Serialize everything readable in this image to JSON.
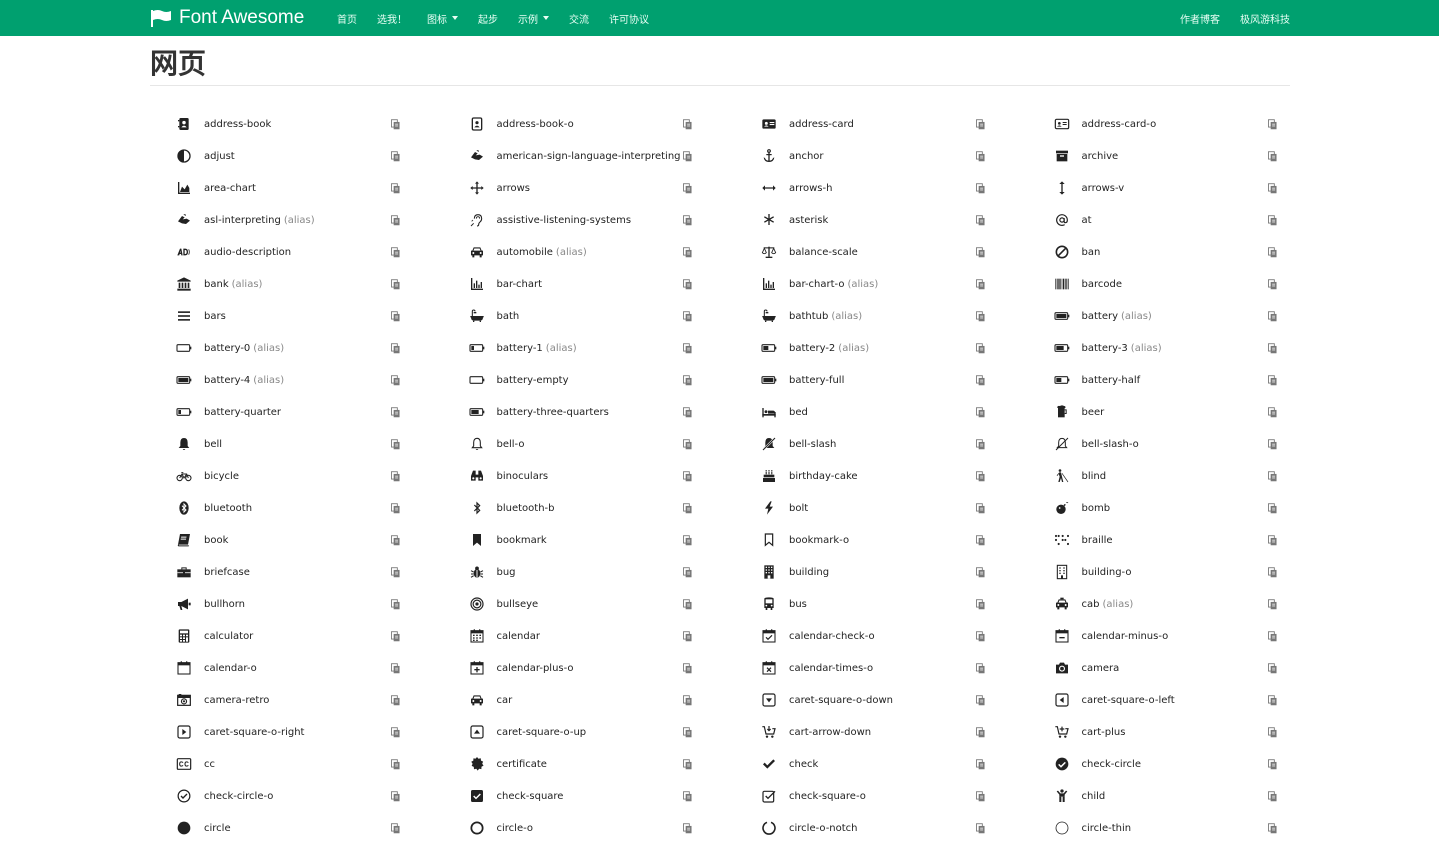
{
  "nav": {
    "brand": "Font Awesome",
    "left": [
      {
        "label": "首页",
        "dropdown": false
      },
      {
        "label": "选我！",
        "dropdown": false
      },
      {
        "label": "图标",
        "dropdown": true
      },
      {
        "label": "起步",
        "dropdown": false
      },
      {
        "label": "示例",
        "dropdown": true
      },
      {
        "label": "交流",
        "dropdown": false
      },
      {
        "label": "许可协议",
        "dropdown": false
      }
    ],
    "right": [
      {
        "label": "作者博客"
      },
      {
        "label": "极风游科技"
      }
    ]
  },
  "section_title": "网页",
  "alias_label": "(alias)",
  "colors": {
    "navbar": "#00a06f",
    "alias": "#888888"
  },
  "icons": [
    {
      "name": "address-book",
      "icon": "address-book-icon",
      "alias": false
    },
    {
      "name": "address-book-o",
      "icon": "address-book-o-icon",
      "alias": false
    },
    {
      "name": "address-card",
      "icon": "address-card-icon",
      "alias": false
    },
    {
      "name": "address-card-o",
      "icon": "address-card-o-icon",
      "alias": false
    },
    {
      "name": "adjust",
      "icon": "adjust-icon",
      "alias": false
    },
    {
      "name": "american-sign-language-interpreting",
      "icon": "asl-icon",
      "alias": false
    },
    {
      "name": "anchor",
      "icon": "anchor-icon",
      "alias": false
    },
    {
      "name": "archive",
      "icon": "archive-icon",
      "alias": false
    },
    {
      "name": "area-chart",
      "icon": "area-chart-icon",
      "alias": false
    },
    {
      "name": "arrows",
      "icon": "arrows-icon",
      "alias": false
    },
    {
      "name": "arrows-h",
      "icon": "arrows-h-icon",
      "alias": false
    },
    {
      "name": "arrows-v",
      "icon": "arrows-v-icon",
      "alias": false
    },
    {
      "name": "asl-interpreting",
      "icon": "asl-icon",
      "alias": true
    },
    {
      "name": "assistive-listening-systems",
      "icon": "ear-icon",
      "alias": false
    },
    {
      "name": "asterisk",
      "icon": "asterisk-icon",
      "alias": false
    },
    {
      "name": "at",
      "icon": "at-icon",
      "alias": false
    },
    {
      "name": "audio-description",
      "icon": "audio-description-icon",
      "alias": false
    },
    {
      "name": "automobile",
      "icon": "car-icon",
      "alias": true
    },
    {
      "name": "balance-scale",
      "icon": "balance-scale-icon",
      "alias": false
    },
    {
      "name": "ban",
      "icon": "ban-icon",
      "alias": false
    },
    {
      "name": "bank",
      "icon": "bank-icon",
      "alias": true
    },
    {
      "name": "bar-chart",
      "icon": "bar-chart-icon",
      "alias": false
    },
    {
      "name": "bar-chart-o",
      "icon": "bar-chart-icon",
      "alias": true
    },
    {
      "name": "barcode",
      "icon": "barcode-icon",
      "alias": false
    },
    {
      "name": "bars",
      "icon": "bars-icon",
      "alias": false
    },
    {
      "name": "bath",
      "icon": "bath-icon",
      "alias": false
    },
    {
      "name": "bathtub",
      "icon": "bath-icon",
      "alias": true
    },
    {
      "name": "battery",
      "icon": "battery-full-icon",
      "alias": true
    },
    {
      "name": "battery-0",
      "icon": "battery-empty-icon",
      "alias": true
    },
    {
      "name": "battery-1",
      "icon": "battery-quarter-icon",
      "alias": true
    },
    {
      "name": "battery-2",
      "icon": "battery-half-icon",
      "alias": true
    },
    {
      "name": "battery-3",
      "icon": "battery-three-quarters-icon",
      "alias": true
    },
    {
      "name": "battery-4",
      "icon": "battery-full-icon",
      "alias": true
    },
    {
      "name": "battery-empty",
      "icon": "battery-empty-icon",
      "alias": false
    },
    {
      "name": "battery-full",
      "icon": "battery-full-icon",
      "alias": false
    },
    {
      "name": "battery-half",
      "icon": "battery-half-icon",
      "alias": false
    },
    {
      "name": "battery-quarter",
      "icon": "battery-quarter-icon",
      "alias": false
    },
    {
      "name": "battery-three-quarters",
      "icon": "battery-three-quarters-icon",
      "alias": false
    },
    {
      "name": "bed",
      "icon": "bed-icon",
      "alias": false
    },
    {
      "name": "beer",
      "icon": "beer-icon",
      "alias": false
    },
    {
      "name": "bell",
      "icon": "bell-icon",
      "alias": false
    },
    {
      "name": "bell-o",
      "icon": "bell-o-icon",
      "alias": false
    },
    {
      "name": "bell-slash",
      "icon": "bell-slash-icon",
      "alias": false
    },
    {
      "name": "bell-slash-o",
      "icon": "bell-slash-o-icon",
      "alias": false
    },
    {
      "name": "bicycle",
      "icon": "bicycle-icon",
      "alias": false
    },
    {
      "name": "binoculars",
      "icon": "binoculars-icon",
      "alias": false
    },
    {
      "name": "birthday-cake",
      "icon": "birthday-cake-icon",
      "alias": false
    },
    {
      "name": "blind",
      "icon": "blind-icon",
      "alias": false
    },
    {
      "name": "bluetooth",
      "icon": "bluetooth-icon",
      "alias": false
    },
    {
      "name": "bluetooth-b",
      "icon": "bluetooth-b-icon",
      "alias": false
    },
    {
      "name": "bolt",
      "icon": "bolt-icon",
      "alias": false
    },
    {
      "name": "bomb",
      "icon": "bomb-icon",
      "alias": false
    },
    {
      "name": "book",
      "icon": "book-icon",
      "alias": false
    },
    {
      "name": "bookmark",
      "icon": "bookmark-icon",
      "alias": false
    },
    {
      "name": "bookmark-o",
      "icon": "bookmark-o-icon",
      "alias": false
    },
    {
      "name": "braille",
      "icon": "braille-icon",
      "alias": false
    },
    {
      "name": "briefcase",
      "icon": "briefcase-icon",
      "alias": false
    },
    {
      "name": "bug",
      "icon": "bug-icon",
      "alias": false
    },
    {
      "name": "building",
      "icon": "building-icon",
      "alias": false
    },
    {
      "name": "building-o",
      "icon": "building-o-icon",
      "alias": false
    },
    {
      "name": "bullhorn",
      "icon": "bullhorn-icon",
      "alias": false
    },
    {
      "name": "bullseye",
      "icon": "bullseye-icon",
      "alias": false
    },
    {
      "name": "bus",
      "icon": "bus-icon",
      "alias": false
    },
    {
      "name": "cab",
      "icon": "cab-icon",
      "alias": true
    },
    {
      "name": "calculator",
      "icon": "calculator-icon",
      "alias": false
    },
    {
      "name": "calendar",
      "icon": "calendar-icon",
      "alias": false
    },
    {
      "name": "calendar-check-o",
      "icon": "calendar-check-o-icon",
      "alias": false
    },
    {
      "name": "calendar-minus-o",
      "icon": "calendar-minus-o-icon",
      "alias": false
    },
    {
      "name": "calendar-o",
      "icon": "calendar-o-icon",
      "alias": false
    },
    {
      "name": "calendar-plus-o",
      "icon": "calendar-plus-o-icon",
      "alias": false
    },
    {
      "name": "calendar-times-o",
      "icon": "calendar-times-o-icon",
      "alias": false
    },
    {
      "name": "camera",
      "icon": "camera-icon",
      "alias": false
    },
    {
      "name": "camera-retro",
      "icon": "camera-retro-icon",
      "alias": false
    },
    {
      "name": "car",
      "icon": "car-icon",
      "alias": false
    },
    {
      "name": "caret-square-o-down",
      "icon": "caret-square-o-down-icon",
      "alias": false
    },
    {
      "name": "caret-square-o-left",
      "icon": "caret-square-o-left-icon",
      "alias": false
    },
    {
      "name": "caret-square-o-right",
      "icon": "caret-square-o-right-icon",
      "alias": false
    },
    {
      "name": "caret-square-o-up",
      "icon": "caret-square-o-up-icon",
      "alias": false
    },
    {
      "name": "cart-arrow-down",
      "icon": "cart-arrow-down-icon",
      "alias": false
    },
    {
      "name": "cart-plus",
      "icon": "cart-plus-icon",
      "alias": false
    },
    {
      "name": "cc",
      "icon": "cc-icon",
      "alias": false
    },
    {
      "name": "certificate",
      "icon": "certificate-icon",
      "alias": false
    },
    {
      "name": "check",
      "icon": "check-icon",
      "alias": false
    },
    {
      "name": "check-circle",
      "icon": "check-circle-icon",
      "alias": false
    },
    {
      "name": "check-circle-o",
      "icon": "check-circle-o-icon",
      "alias": false
    },
    {
      "name": "check-square",
      "icon": "check-square-icon",
      "alias": false
    },
    {
      "name": "check-square-o",
      "icon": "check-square-o-icon",
      "alias": false
    },
    {
      "name": "child",
      "icon": "child-icon",
      "alias": false
    },
    {
      "name": "circle",
      "icon": "circle-icon",
      "alias": false
    },
    {
      "name": "circle-o",
      "icon": "circle-o-icon",
      "alias": false
    },
    {
      "name": "circle-o-notch",
      "icon": "circle-o-notch-icon",
      "alias": false
    },
    {
      "name": "circle-thin",
      "icon": "circle-thin-icon",
      "alias": false
    }
  ]
}
